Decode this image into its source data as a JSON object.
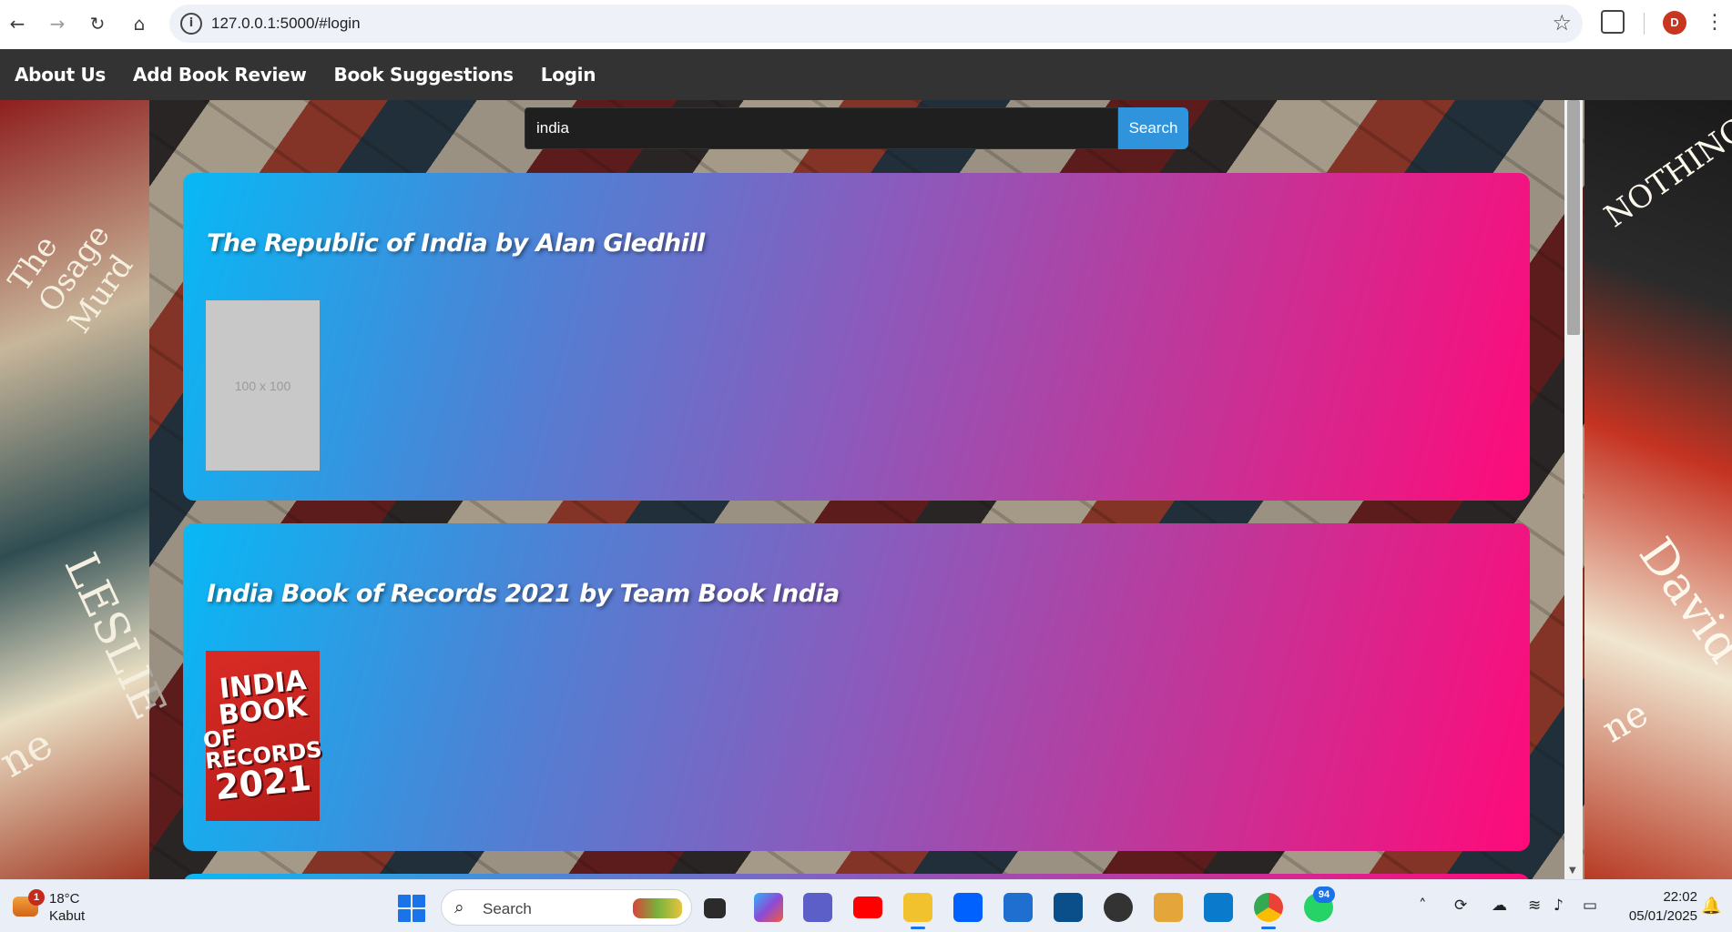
{
  "browser": {
    "url": "127.0.0.1:5000/#login",
    "profile_initial": "D"
  },
  "nav": {
    "items": [
      "About Us",
      "Add Book Review",
      "Book Suggestions",
      "Login"
    ]
  },
  "search": {
    "value": "india",
    "button_label": "Search"
  },
  "results": [
    {
      "title": "The Republic of India by Alan Gledhill",
      "cover_type": "placeholder",
      "cover_text": "100 x 100"
    },
    {
      "title": "India Book of Records 2021 by Team Book India",
      "cover_type": "image",
      "cover_lines": [
        "INDIA",
        "BOOK",
        "OF RECORDS",
        "2021"
      ]
    }
  ],
  "background_cover_text": {
    "left": [
      "The Osage Murd",
      "LESLIE",
      "ne"
    ],
    "right": [
      "NOTHING",
      "David",
      "ne"
    ]
  },
  "taskbar": {
    "weather": {
      "temp": "18°C",
      "condition": "Kabut",
      "alert_count": "1"
    },
    "search_label": "Search",
    "whatsapp_badge": "94",
    "time": "22:02",
    "date": "05/01/2025"
  },
  "colors": {
    "nav_bg": "#333333",
    "search_button": "#2f94dc",
    "card_gradient_start": "#08b8f5",
    "card_gradient_end": "#ff0a7a"
  }
}
